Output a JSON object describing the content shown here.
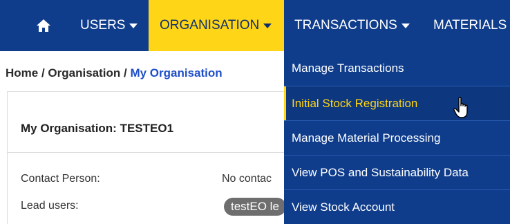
{
  "nav": {
    "home_icon": "home-icon",
    "items": [
      {
        "label": "USERS"
      },
      {
        "label": "ORGANISATION"
      },
      {
        "label": "TRANSACTIONS"
      },
      {
        "label": "MATERIALS"
      }
    ],
    "active_color": "#ffd617",
    "bar_color": "#0f3d8c"
  },
  "breadcrumb": {
    "home": "Home",
    "sep1": " / ",
    "section": "Organisation",
    "sep2": " / ",
    "current": "My Organisation"
  },
  "panel": {
    "title": "My Organisation: TESTEO1",
    "rows": [
      {
        "label": "Contact Person:",
        "value": "No contac"
      },
      {
        "label": "Lead users:",
        "value": "testEO le"
      }
    ]
  },
  "dropdown": {
    "items": [
      {
        "label": "Manage Transactions"
      },
      {
        "label": "Initial Stock Registration"
      },
      {
        "label": "Manage Material Processing"
      },
      {
        "label": "View POS and Sustainability Data"
      },
      {
        "label": "View Stock Account"
      }
    ]
  },
  "cursor_icon": "hand-pointer-icon"
}
